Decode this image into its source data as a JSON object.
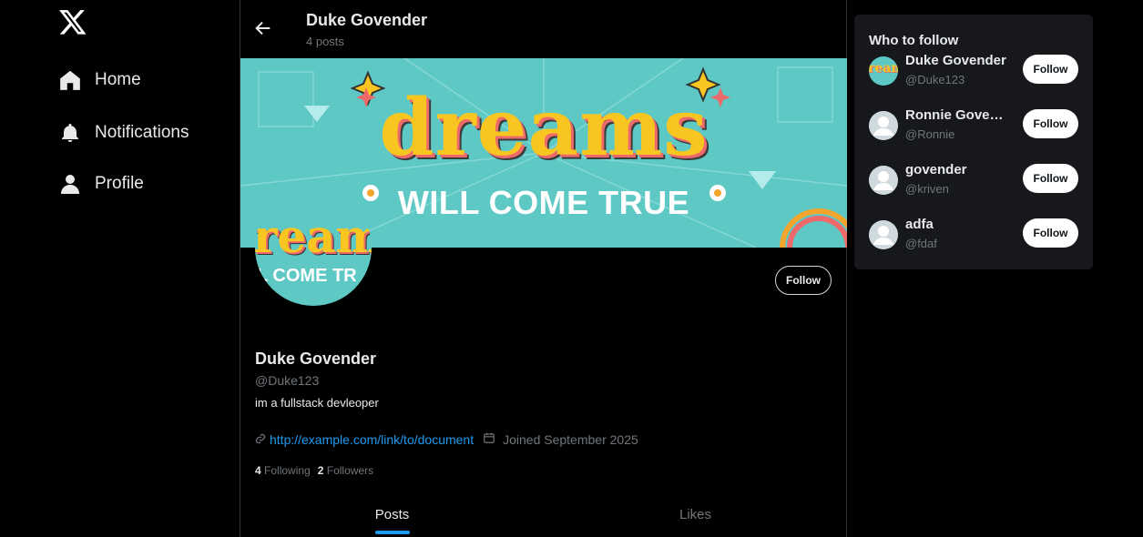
{
  "nav": {
    "items": [
      {
        "label": "Home",
        "icon": "home-icon"
      },
      {
        "label": "Notifications",
        "icon": "bell-icon"
      },
      {
        "label": "Profile",
        "icon": "person-icon"
      }
    ]
  },
  "header": {
    "name": "Duke Govender",
    "posts": "4 posts"
  },
  "banner": {
    "title": "dreams",
    "subtitle": "WILL COME TRUE"
  },
  "avatar": {
    "line1": "ream",
    "line2": "L COME TR"
  },
  "profile": {
    "follow_label": "Follow",
    "name": "Duke Govender",
    "handle": "@Duke123",
    "bio": "im a fullstack devleoper",
    "link": "http://example.com/link/to/document",
    "joined": "Joined September 2025",
    "following_count": "4",
    "following_label": "Following",
    "followers_count": "2",
    "followers_label": "Followers"
  },
  "tabs": [
    {
      "label": "Posts",
      "active": true
    },
    {
      "label": "Likes",
      "active": false
    }
  ],
  "who_to_follow": {
    "title": "Who to follow",
    "avatar_text": "ream",
    "suggestions": [
      {
        "name": "Duke Govender",
        "handle": "@Duke123",
        "button": "Follow"
      },
      {
        "name": "Ronnie Govender",
        "handle": "@Ronnie",
        "button": "Follow"
      },
      {
        "name": "govender",
        "handle": "@kriven",
        "button": "Follow"
      },
      {
        "name": "adfa",
        "handle": "@fdaf",
        "button": "Follow"
      }
    ]
  },
  "colors": {
    "background": "#000000",
    "accent": "#1d9bf0",
    "banner": "#5ec8c5",
    "panel": "#16181c"
  }
}
